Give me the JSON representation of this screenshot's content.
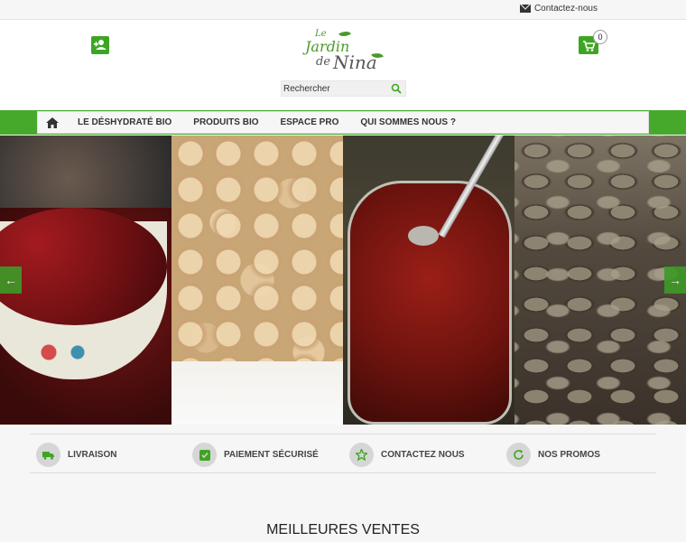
{
  "topbar": {
    "contact_label": "Contactez-nous"
  },
  "header": {
    "logo": {
      "line1": "Le",
      "line2": "Jardin",
      "line3": "de",
      "line4": "Nina"
    },
    "cart_count": "0",
    "search": {
      "placeholder": "Rechercher"
    }
  },
  "nav": {
    "items": [
      {
        "label": "LE DÉSHYDRATÉ BIO"
      },
      {
        "label": "PRODUITS BIO"
      },
      {
        "label": "ESPACE PRO"
      },
      {
        "label": "QUI SOMMES NOUS ?"
      }
    ]
  },
  "slider": {
    "left_arrow": "←",
    "right_arrow": "→",
    "slides": [
      {
        "icon": "red-kidney-beans-photo"
      },
      {
        "icon": "chickpeas-photo"
      },
      {
        "icon": "dried-tomatoes-jar-photo"
      },
      {
        "icon": "pumpkin-seeds-photo"
      }
    ]
  },
  "reassurance": {
    "items": [
      {
        "label": "LIVRAISON",
        "icon": "truck-icon"
      },
      {
        "label": "PAIEMENT SÉCURISÉ",
        "icon": "secure-payment-icon"
      },
      {
        "label": "CONTACTEZ NOUS",
        "icon": "star-icon"
      },
      {
        "label": "NOS PROMOS",
        "icon": "refresh-icon"
      }
    ]
  },
  "main": {
    "section_title": "MEILLEURES VENTES"
  },
  "colors": {
    "brand_green": "#3ea524",
    "nav_band": "#47a92c",
    "page_bg": "#f6f6f6"
  }
}
